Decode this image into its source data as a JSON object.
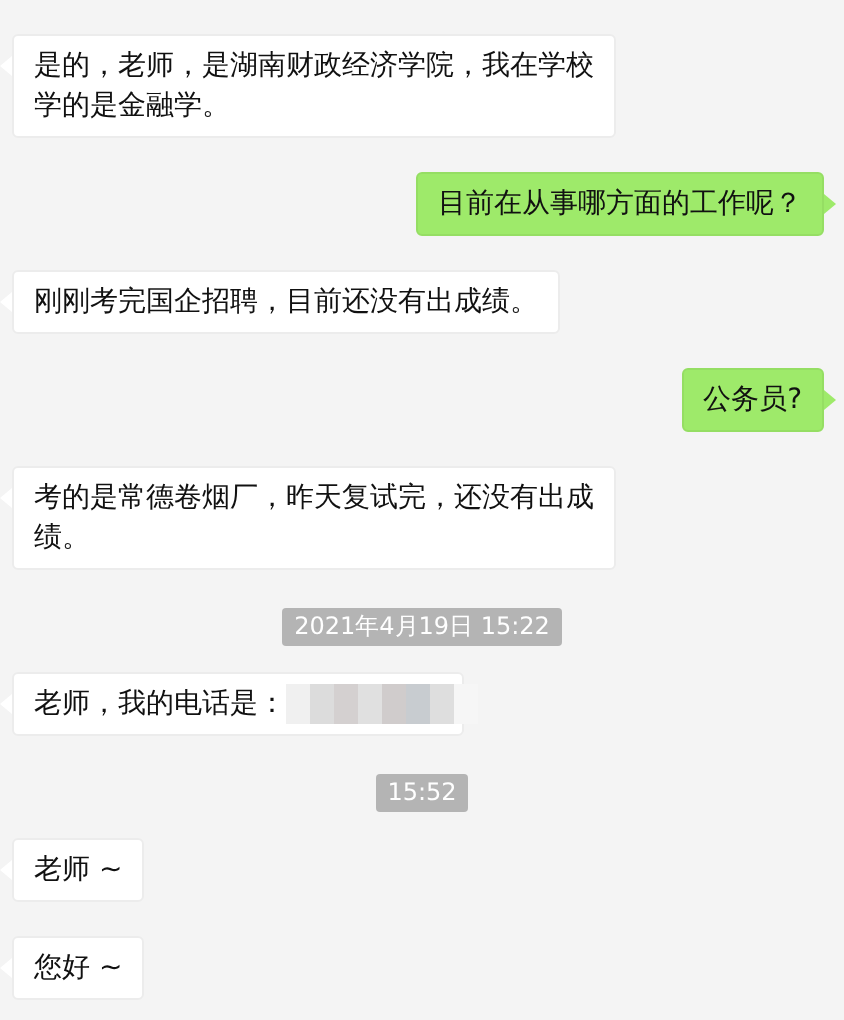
{
  "messages": [
    {
      "kind": "received",
      "text": "是的，老师，是湖南财政经济学院，我在学校学的是金融学。",
      "blurred": false
    },
    {
      "kind": "sent",
      "text": "目前在从事哪方面的工作呢？",
      "blurred": false
    },
    {
      "kind": "received",
      "text": "刚刚考完国企招聘，目前还没有出成绩。",
      "blurred": false
    },
    {
      "kind": "sent",
      "text": "公务员?",
      "blurred": false
    },
    {
      "kind": "received",
      "text": "考的是常德卷烟厂，昨天复试完，还没有出成绩。",
      "blurred": false
    },
    {
      "kind": "timestamp",
      "text": "2021年4月19日 15:22"
    },
    {
      "kind": "received",
      "text": "老师，我的电话是：",
      "blurred": true
    },
    {
      "kind": "timestamp",
      "text": "15:52"
    },
    {
      "kind": "received",
      "text": "老师 ~",
      "blurred": false
    },
    {
      "kind": "received",
      "text": "您好 ~",
      "blurred": false
    }
  ]
}
